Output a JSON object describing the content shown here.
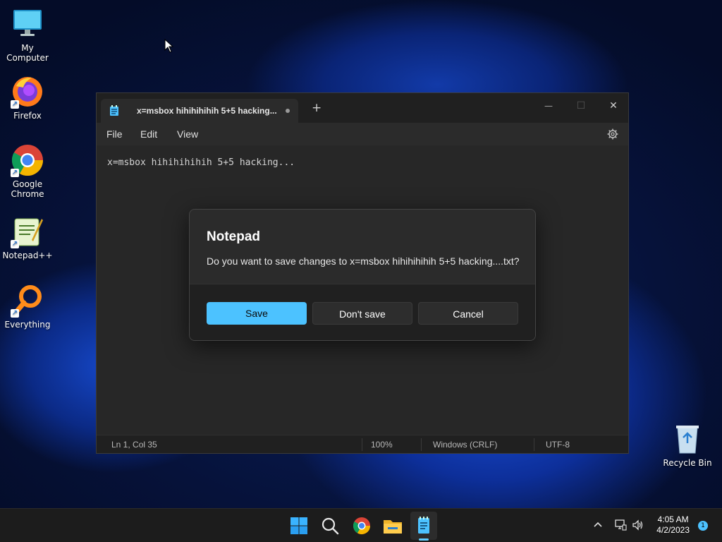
{
  "desktop": {
    "icons": [
      {
        "label": "My Computer"
      },
      {
        "label": "Firefox"
      },
      {
        "label": "Google Chrome"
      },
      {
        "label": "Notepad++"
      },
      {
        "label": "Everything"
      },
      {
        "label": "Recycle Bin"
      }
    ]
  },
  "notepad": {
    "tab_title": "x=msbox hihihihihih 5+5 hacking...",
    "new_tab": "+",
    "controls": {
      "minimize": "—",
      "maximize": "☐",
      "close": "✕"
    },
    "menu": [
      "File",
      "Edit",
      "View"
    ],
    "content": "x=msbox hihihihihih 5+5 hacking...",
    "status": {
      "position": "Ln 1, Col 35",
      "zoom": "100%",
      "line_ending": "Windows (CRLF)",
      "encoding": "UTF-8"
    }
  },
  "dialog": {
    "title": "Notepad",
    "message": "Do you want to save changes to x=msbox hihihihihih 5+5 hacking....txt?",
    "buttons": {
      "save": "Save",
      "dont_save": "Don't save",
      "cancel": "Cancel"
    }
  },
  "taskbar": {
    "apps": [
      "start-icon",
      "search-icon",
      "chrome-icon",
      "file-explorer-icon",
      "notepad-icon"
    ],
    "clock_time": "4:05 AM",
    "clock_date": "4/2/2023",
    "notification_count": "1"
  },
  "colors": {
    "accent": "#4cc2ff",
    "window_bg": "#272727",
    "taskbar_bg": "#1c1c1c"
  }
}
